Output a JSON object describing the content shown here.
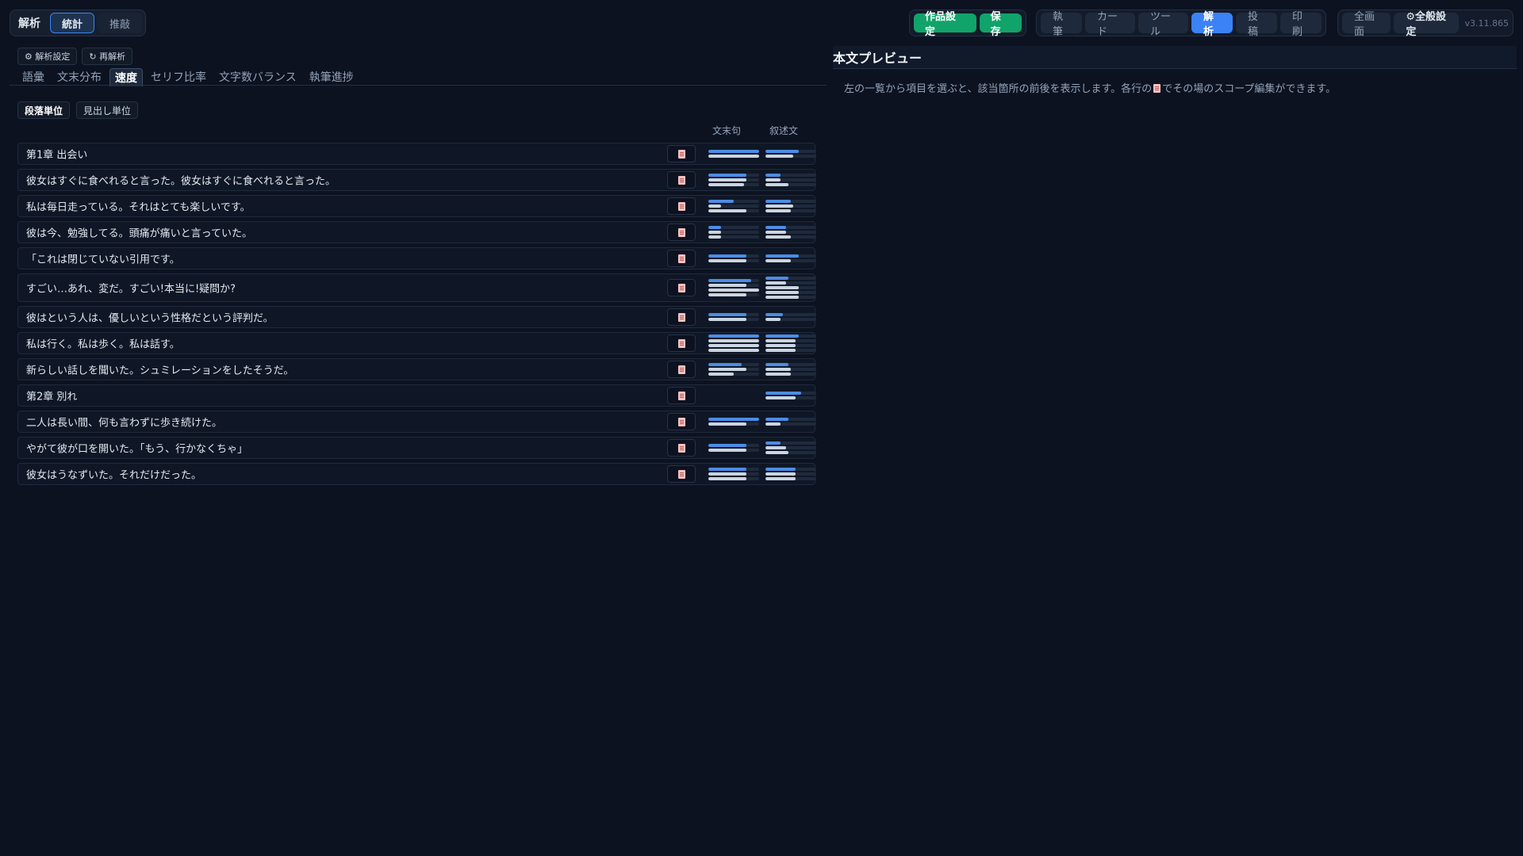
{
  "mode": {
    "label": "解析",
    "tabs": [
      {
        "label": "統計"
      },
      {
        "label": "推敲"
      }
    ]
  },
  "top": {
    "work_settings": "作品設定",
    "save": "保存",
    "nav": [
      {
        "label": "執筆"
      },
      {
        "label": "カード"
      },
      {
        "label": "ツール"
      },
      {
        "label": "解析"
      },
      {
        "label": "投稿"
      },
      {
        "label": "印刷"
      }
    ],
    "fullscreen": "全画面",
    "general_settings": "⚙全般設定",
    "version": "v3.11.865"
  },
  "toolbar": {
    "analysis_settings": "⚙ 解析設定",
    "reanalyze": "↻ 再解析"
  },
  "tabs": [
    {
      "label": "語彙"
    },
    {
      "label": "文末分布"
    },
    {
      "label": "速度"
    },
    {
      "label": "セリフ比率"
    },
    {
      "label": "文字数バランス"
    },
    {
      "label": "執筆進捗"
    }
  ],
  "units": {
    "paragraph": "段落単位",
    "heading": "見出し単位"
  },
  "columns": {
    "c1": "文末句",
    "c2": "叙述文"
  },
  "rows": [
    {
      "text": "第1章 出会い"
    },
    {
      "text": "彼女はすぐに食べれると言った。彼女はすぐに食べれると言った。"
    },
    {
      "text": "私は毎日走っている。それはとても楽しいです。"
    },
    {
      "text": "彼は今、勉強してる。頭痛が痛いと言っていた。"
    },
    {
      "text": "「これは閉じていない引用です。"
    },
    {
      "text": "すごい…あれ、変だ。すごい!本当に!疑問か?"
    },
    {
      "text": "彼はという人は、優しいという性格だという評判だ。"
    },
    {
      "text": "私は行く。私は歩く。私は話す。"
    },
    {
      "text": "新らしい話しを聞いた。シュミレーションをしたそうだ。"
    },
    {
      "text": "第2章 別れ"
    },
    {
      "text": "二人は長い間、何も言わずに歩き続けた。"
    },
    {
      "text": "やがて彼が口を開いた。「もう、行かなくちゃ」"
    },
    {
      "text": "彼女はうなずいた。それだけだった。"
    }
  ],
  "preview": {
    "title": "本文プレビュー",
    "hint_before": "左の一覧から項目を選ぶと、該当箇所の前後を表示します。各行の",
    "hint_after": "でその場のスコープ編集ができます。"
  }
}
